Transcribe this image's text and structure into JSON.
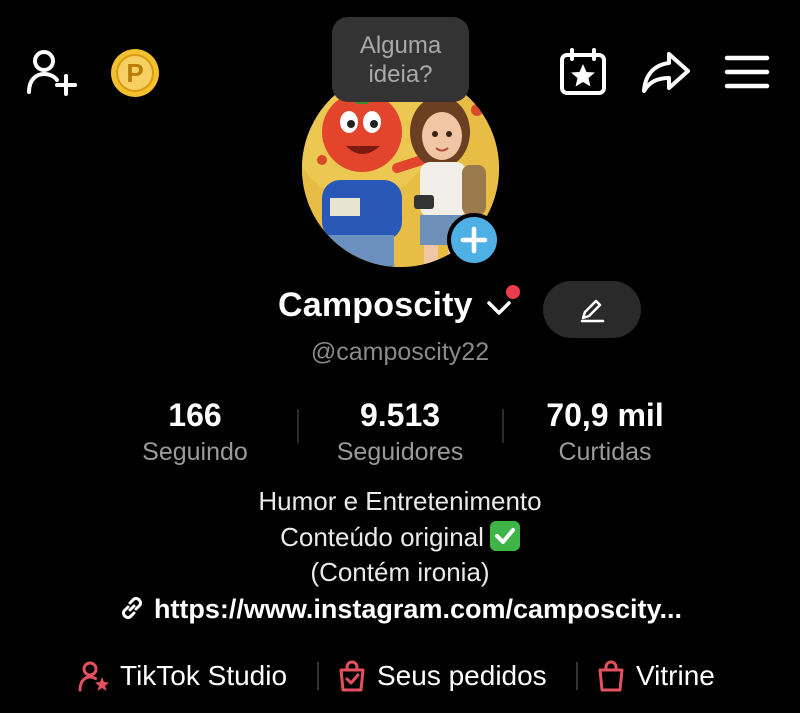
{
  "tooltip": {
    "text": "Alguma\nideia?"
  },
  "profile": {
    "display_name": "Camposcity",
    "username": "@camposcity22"
  },
  "stats": [
    {
      "value": "166",
      "label": "Seguindo"
    },
    {
      "value": "9.513",
      "label": "Seguidores"
    },
    {
      "value": "70,9 mil",
      "label": "Curtidas"
    }
  ],
  "bio": {
    "line1": "Humor e Entretenimento",
    "line2": "Conteúdo original",
    "line3": "(Contém ironia)",
    "link": "https://www.instagram.com/camposcity..."
  },
  "bottom_links": {
    "studio": "TikTok Studio",
    "orders": "Seus pedidos",
    "storefront": "Vitrine"
  },
  "colors": {
    "background": "#000000",
    "add_story_button": "#4fb0e6",
    "notification_dot": "#ea3e4f",
    "accent_icon": "#e4505e",
    "coin": "#f3c030"
  },
  "icons": {
    "top_left": [
      "add-friend-icon",
      "coin-icon"
    ],
    "top_right": [
      "calendar-star-icon",
      "share-icon",
      "menu-icon"
    ]
  }
}
